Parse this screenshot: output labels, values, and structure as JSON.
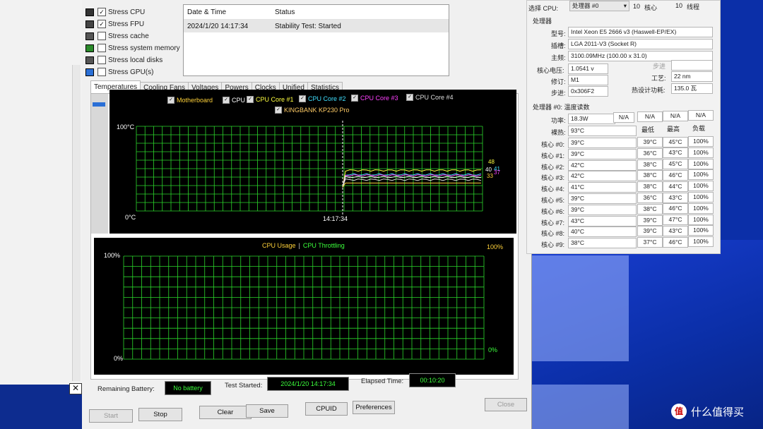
{
  "stress_options": [
    {
      "label": "Stress CPU",
      "checked": true
    },
    {
      "label": "Stress FPU",
      "checked": true
    },
    {
      "label": "Stress cache",
      "checked": false
    },
    {
      "label": "Stress system memory",
      "checked": false
    },
    {
      "label": "Stress local disks",
      "checked": false
    },
    {
      "label": "Stress GPU(s)",
      "checked": false
    }
  ],
  "log": {
    "col_date": "Date & Time",
    "col_status": "Status",
    "row_date": "2024/1/20 14:17:34",
    "row_status": "Stability Test: Started"
  },
  "tabs": [
    "Temperatures",
    "Cooling Fans",
    "Voltages",
    "Powers",
    "Clocks",
    "Unified",
    "Statistics"
  ],
  "temp_chart": {
    "legend": [
      {
        "label": "Motherboard",
        "color": "#ffd23a"
      },
      {
        "label": "CPU",
        "color": "#ffffff"
      },
      {
        "label": "CPU Core #1",
        "color": "#ffff40"
      },
      {
        "label": "CPU Core #2",
        "color": "#40e0ff"
      },
      {
        "label": "CPU Core #3",
        "color": "#ff40ff"
      },
      {
        "label": "CPU Core #4",
        "color": "#dddddd"
      },
      {
        "label": "KINGBANK KP230 Pro",
        "color": "#ffcc66"
      }
    ],
    "y_top": "100°C",
    "y_bottom": "0°C",
    "x_label": "14:17:34",
    "end_labels": [
      {
        "text": "48",
        "color": "#ffff40"
      },
      {
        "text": "40",
        "color": "#ffffff"
      },
      {
        "text": "41",
        "color": "#40e0ff"
      },
      {
        "text": "37",
        "color": "#ff40ff"
      },
      {
        "text": "33",
        "color": "#ffd23a"
      }
    ]
  },
  "usage_chart": {
    "legend_usage": "CPU Usage",
    "legend_sep": "|",
    "legend_throttle": "CPU Throttling",
    "y_top_left": "100%",
    "y_bottom_left": "0%",
    "y_top_right": "100%",
    "y_bottom_right": "0%"
  },
  "status_bar": {
    "battery_label": "Remaining Battery:",
    "battery_value": "No battery",
    "started_label": "Test Started:",
    "started_value": "2024/1/20 14:17:34",
    "elapsed_label": "Elapsed Time:",
    "elapsed_value": "00:10:20"
  },
  "buttons": {
    "start": "Start",
    "stop": "Stop",
    "clear": "Clear",
    "save": "Save",
    "cpuid": "CPUID",
    "preferences": "Preferences",
    "close": "Close"
  },
  "close_x": "✕",
  "cpu_panel": {
    "select_label": "选择 CPU:",
    "select_value": "处理器 #0",
    "cores_num": "10",
    "cores_label": "核心",
    "threads_num": "10",
    "threads_label": "线程",
    "section_processor": "处理器",
    "model_label": "型号:",
    "model_value": "Intel Xeon E5 2666 v3 (Haswell-EP/EX)",
    "socket_label": "插槽:",
    "socket_value": "LGA 2011-V3 (Socket R)",
    "clock_label": "主频:",
    "clock_value": "3100.09MHz (100.00 x 31.0)",
    "voltage_label": "核心电压:",
    "voltage_value": "1.0541 v",
    "stepping_label": "步进",
    "revision_label": "修订:",
    "revision_value": "M1",
    "process_label": "工艺:",
    "process_value": "22 nm",
    "step_label": "步进:",
    "step_value": "0x306F2",
    "tdp_label": "热设计功耗:",
    "tdp_value": "135.0 瓦",
    "section_temps": "处理器 #0: 温度读数",
    "power_label": "功率:",
    "power_value": "18.3W",
    "na": [
      "N/A",
      "N/A",
      "N/A",
      "N/A"
    ],
    "pkg_label": "裸热:",
    "pkg_value": "93°C",
    "col_min": "最低",
    "col_max": "最高",
    "col_load": "负载",
    "cores": [
      {
        "label": "核心 #0:",
        "temp": "39°C",
        "min": "39°C",
        "max": "45°C",
        "load": "100%"
      },
      {
        "label": "核心 #1:",
        "temp": "39°C",
        "min": "36°C",
        "max": "43°C",
        "load": "100%"
      },
      {
        "label": "核心 #2:",
        "temp": "42°C",
        "min": "38°C",
        "max": "45°C",
        "load": "100%"
      },
      {
        "label": "核心 #3:",
        "temp": "42°C",
        "min": "38°C",
        "max": "46°C",
        "load": "100%"
      },
      {
        "label": "核心 #4:",
        "temp": "41°C",
        "min": "38°C",
        "max": "44°C",
        "load": "100%"
      },
      {
        "label": "核心 #5:",
        "temp": "39°C",
        "min": "36°C",
        "max": "43°C",
        "load": "100%"
      },
      {
        "label": "核心 #6:",
        "temp": "39°C",
        "min": "38°C",
        "max": "46°C",
        "load": "100%"
      },
      {
        "label": "核心 #7:",
        "temp": "43°C",
        "min": "39°C",
        "max": "47°C",
        "load": "100%"
      },
      {
        "label": "核心 #8:",
        "temp": "40°C",
        "min": "39°C",
        "max": "43°C",
        "load": "100%"
      },
      {
        "label": "核心 #9:",
        "temp": "38°C",
        "min": "37°C",
        "max": "46°C",
        "load": "100%"
      }
    ]
  },
  "watermark_text": "什么值得买",
  "watermark_logo": "值"
}
